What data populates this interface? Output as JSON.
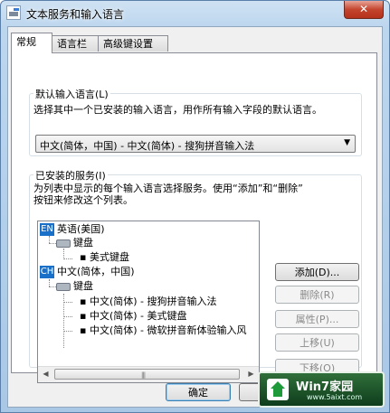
{
  "window": {
    "title": "文本服务和输入语言",
    "close_label": "✕"
  },
  "tabs": [
    "常规",
    "语言栏",
    "高级键设置"
  ],
  "default_language": {
    "group_label": "默认输入语言(L)",
    "description": "选择其中一个已安装的输入语言，用作所有输入字段的默认语言。",
    "selected": "中文(简体，中国) - 中文(简体) - 搜狗拼音输入法"
  },
  "installed": {
    "group_label": "已安装的服务(I)",
    "description_line1": "为列表中显示的每个输入语言选择服务。使用“添加”和“删除”",
    "description_line2": "按钮来修改这个列表。",
    "tree": {
      "lang1_badge": "EN",
      "lang1": "英语(美国)",
      "lang1_keyboard": "键盘",
      "lang1_kb1": "美式键盘",
      "lang2_badge": "CH",
      "lang2": "中文(简体，中国)",
      "lang2_keyboard": "键盘",
      "lang2_kb1": "中文(简体) - 搜狗拼音输入法",
      "lang2_kb2": "中文(简体) - 美式键盘",
      "lang2_kb3": "中文(简体) - 微软拼音新体验输入风"
    },
    "buttons": {
      "add": "添加(D)...",
      "remove": "删除(R)",
      "properties": "属性(P)...",
      "move_up": "上移(U)",
      "move_down": "下移(O)"
    }
  },
  "footer": {
    "ok": "确定"
  },
  "watermark": {
    "name": "Win7家园",
    "url": "www.5aixt.com"
  }
}
